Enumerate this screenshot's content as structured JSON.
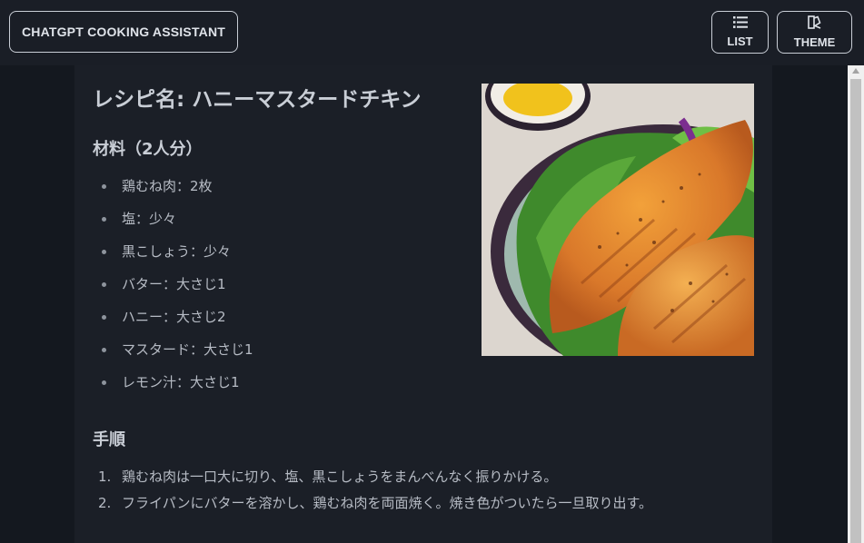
{
  "header": {
    "brand_label": "CHATGPT COOKING ASSISTANT",
    "list_label": "LIST",
    "theme_label": "THEME"
  },
  "recipe": {
    "title": "レシピ名: ハニーマスタードチキン",
    "ingredients_heading": "材料（2人分）",
    "ingredients": [
      "鶏むね肉：2枚",
      "塩：少々",
      "黒こしょう：少々",
      "バター：大さじ1",
      "ハニー：大さじ2",
      "マスタード：大さじ1",
      "レモン汁：大さじ1"
    ],
    "steps_heading": "手順",
    "steps": [
      {
        "num": "1.",
        "text": "鶏むね肉は一口大に切り、塩、黒こしょうをまんべんなく振りかける。"
      },
      {
        "num": "2.",
        "text": "フライパンにバターを溶かし、鶏むね肉を両面焼く。焼き色がついたら一旦取り出す。"
      }
    ]
  },
  "icons": {
    "list": "list-icon",
    "theme": "theme-icon"
  },
  "colors": {
    "header_bg": "#1a1e26",
    "content_bg": "#1b1f27",
    "text": "#c9ced6"
  }
}
